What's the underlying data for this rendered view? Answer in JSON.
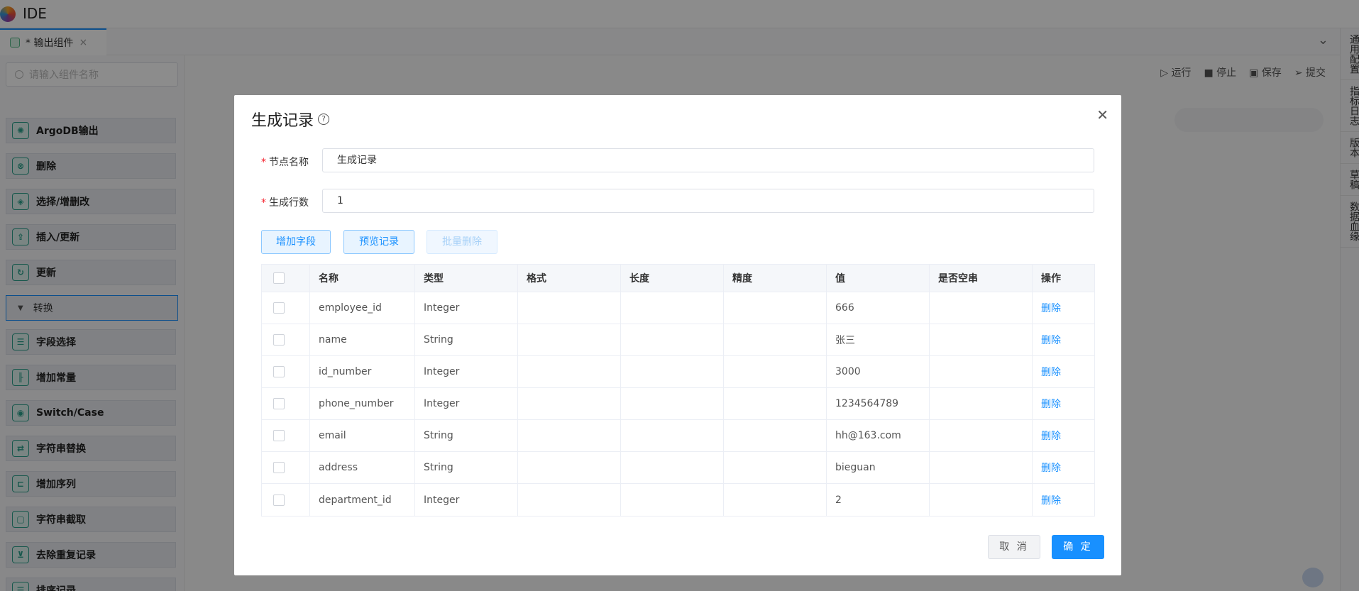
{
  "app": {
    "title": "IDE"
  },
  "tab": {
    "label": "* 输出组件",
    "close": "×"
  },
  "right_panel": [
    "通用配置",
    "指标日志",
    "版本",
    "草稿",
    "数据血缘"
  ],
  "sidebar": {
    "search_placeholder": "请输入组件名称",
    "items": [
      "ArgoDB输出",
      "删除",
      "选择/增删改",
      "插入/更新",
      "更新"
    ],
    "group": "转换",
    "group_items": [
      "字段选择",
      "增加常量",
      "Switch/Case",
      "字符串替换",
      "增加序列",
      "字符串截取",
      "去除重复记录",
      "排序记录"
    ]
  },
  "toolbar": {
    "run": "运行",
    "stop": "停止",
    "save": "保存",
    "submit": "提交"
  },
  "modal": {
    "title": "生成记录",
    "fields": {
      "node_name_label": "节点名称",
      "node_name_value": "生成记录",
      "rows_label": "生成行数",
      "rows_value": "1"
    },
    "buttons": {
      "add_field": "增加字段",
      "preview": "预览记录",
      "batch_delete": "批量删除",
      "cancel": "取 消",
      "ok": "确 定"
    },
    "table": {
      "columns": [
        "名称",
        "类型",
        "格式",
        "长度",
        "精度",
        "值",
        "是否空串",
        "操作"
      ],
      "rows": [
        {
          "name": "employee_id",
          "type": "Integer",
          "format": "",
          "length": "",
          "precision": "",
          "value": "666",
          "empty": "",
          "action": "删除"
        },
        {
          "name": "name",
          "type": "String",
          "format": "",
          "length": "",
          "precision": "",
          "value": "张三",
          "empty": "",
          "action": "删除"
        },
        {
          "name": "id_number",
          "type": "Integer",
          "format": "",
          "length": "",
          "precision": "",
          "value": "3000",
          "empty": "",
          "action": "删除"
        },
        {
          "name": "phone_number",
          "type": "Integer",
          "format": "",
          "length": "",
          "precision": "",
          "value": "1234564789",
          "empty": "",
          "action": "删除"
        },
        {
          "name": "email",
          "type": "String",
          "format": "",
          "length": "",
          "precision": "",
          "value": "hh@163.com",
          "empty": "",
          "action": "删除"
        },
        {
          "name": "address",
          "type": "String",
          "format": "",
          "length": "",
          "precision": "",
          "value": "bieguan",
          "empty": "",
          "action": "删除"
        },
        {
          "name": "department_id",
          "type": "Integer",
          "format": "",
          "length": "",
          "precision": "",
          "value": "2",
          "empty": "",
          "action": "删除"
        }
      ]
    }
  }
}
